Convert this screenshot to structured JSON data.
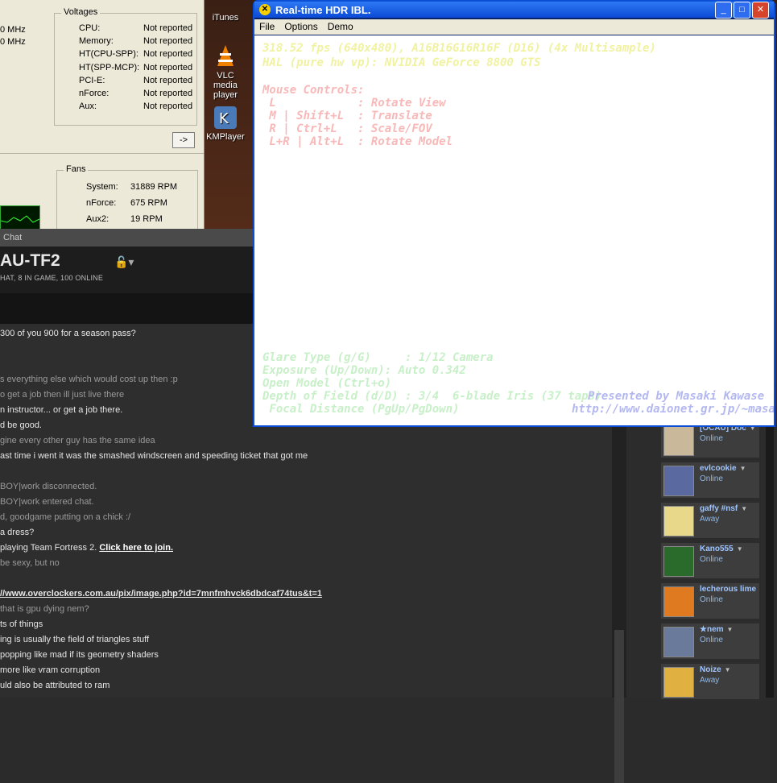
{
  "hwmon": {
    "freq_lines": [
      "0 MHz",
      "0 MHz"
    ],
    "voltages": {
      "title": "Voltages",
      "rows": [
        {
          "label": "CPU:",
          "value": "Not reported"
        },
        {
          "label": "Memory:",
          "value": "Not reported"
        },
        {
          "label": "HT(CPU-SPP):",
          "value": "Not reported"
        },
        {
          "label": "HT(SPP-MCP):",
          "value": "Not reported"
        },
        {
          "label": "PCI-E:",
          "value": "Not reported"
        },
        {
          "label": "nForce:",
          "value": "Not reported"
        },
        {
          "label": "Aux:",
          "value": "Not reported"
        }
      ]
    },
    "arrow_button": "->",
    "fans": {
      "title": "Fans",
      "rows": [
        {
          "label": "System:",
          "value": "31889 RPM"
        },
        {
          "label": "nForce:",
          "value": "675 RPM"
        },
        {
          "label": "Aux2:",
          "value": "19 RPM"
        }
      ]
    }
  },
  "desktop_icons": [
    {
      "label": "iTunes"
    },
    {
      "label": "VLC media player"
    },
    {
      "label": "KMPlayer"
    }
  ],
  "hdr_window": {
    "title": "Real-time HDR IBL.",
    "menu": [
      "File",
      "Options",
      "Demo"
    ],
    "overlay": {
      "fps_line": "318.52 fps (640x480), A16B16G16R16F (D16) (4x Multisample)",
      "hal_line": "HAL (pure hw vp): NVIDIA GeForce 8800 GTS",
      "mouse_title": "Mouse Controls:",
      "controls": [
        " L            : Rotate View",
        " M | Shift+L  : Translate",
        " R | Ctrl+L   : Scale/FOV",
        " L+R | Alt+L  : Rotate Model"
      ],
      "glare": "Glare Type (g/G)     : 1/12 Camera",
      "exposure": "Exposure (Up/Down): Auto 0.342",
      "open_model": "Open Model (Ctrl+o)",
      "dof": "Depth of Field (d/D) : 3/4  6-blade Iris (37 taps)",
      "focal": " Focal Distance (PgUp/PgDown)",
      "credit": "Presented by Masaki Kawase",
      "url": "http://www.daionet.gr.jp/~masa"
    }
  },
  "chat": {
    "window_title": "Chat",
    "room_name": "AU-TF2",
    "status": "HAT, 8 IN GAME, 100 ONLINE",
    "messages": [
      {
        "text": "300 of you 900 for a season pass?",
        "style": "normal"
      },
      {
        "text": "s everything else which would cost up then :p",
        "style": "dim"
      },
      {
        "text": "o get a job then ill just live there",
        "style": "dim"
      },
      {
        "text": "n instructor... or get a job there.",
        "style": "normal"
      },
      {
        "text": "d be good.",
        "style": "normal"
      },
      {
        "text": "gine every other guy has the same idea",
        "style": "dim"
      },
      {
        "text": "ast time i went it was the smashed windscreen and speeding ticket that got me",
        "style": "normal"
      },
      {
        "text": "BOY|work disconnected.",
        "style": "dim"
      },
      {
        "text": "BOY|work entered chat.",
        "style": "dim"
      },
      {
        "text": "d, goodgame putting on a chick :/",
        "style": "dim"
      },
      {
        "text": "a dress?",
        "style": "normal"
      },
      {
        "text": "playing Team Fortress 2.",
        "style": "normal",
        "link": "Click here to join."
      },
      {
        "text": "be sexy, but no",
        "style": "dim"
      },
      {
        "text": "//www.overclockers.com.au/pix/image.php?id=7mnfmhvck6dbdcaf74tus&t=1",
        "style": "link"
      },
      {
        "text": "that is gpu dying nem?",
        "style": "dim"
      },
      {
        "text": "ts of things",
        "style": "normal"
      },
      {
        "text": "ing is usually the field of triangles stuff",
        "style": "normal"
      },
      {
        "text": "popping like mad if its geometry shaders",
        "style": "normal"
      },
      {
        "text": "more like vram corruption",
        "style": "normal"
      },
      {
        "text": "uld also be attributed to ram",
        "style": "normal"
      }
    ]
  },
  "friends": [
    {
      "name": "[OCAU] Doc",
      "status": "Online",
      "color": "#c9b89a"
    },
    {
      "name": "evlcookie",
      "status": "Online",
      "color": "#5a6aa0"
    },
    {
      "name": "gaffy #nsf",
      "status": "Away",
      "color": "#e8d98a"
    },
    {
      "name": "Kano555",
      "status": "Online",
      "color": "#2a6a2a"
    },
    {
      "name": "lecherous lime",
      "status": "Online",
      "color": "#e07a20"
    },
    {
      "name": "★nem",
      "status": "Online",
      "color": "#6a7a9a"
    },
    {
      "name": "Noize",
      "status": "Away",
      "color": "#e0b040"
    }
  ]
}
